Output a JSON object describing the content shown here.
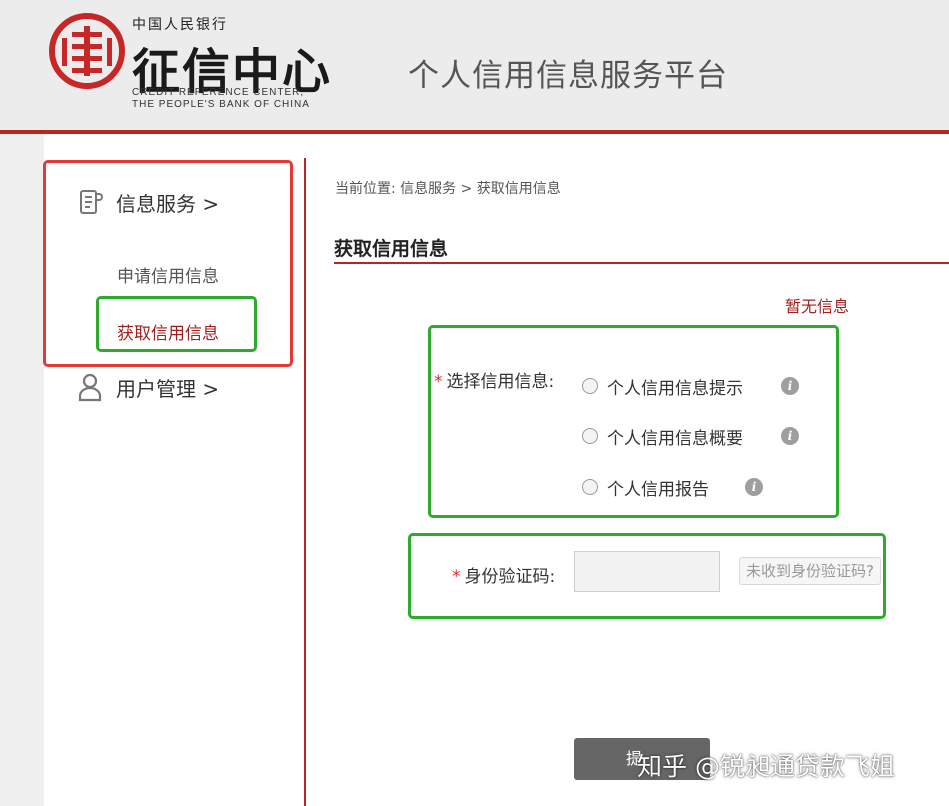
{
  "header": {
    "logo_top": "中国人民银行",
    "logo_main": "征信中心",
    "logo_en_line1": "CREDIT REFERENCE CENTER,",
    "logo_en_line2": "THE PEOPLE'S BANK OF CHINA",
    "platform_title": "个人信用信息服务平台"
  },
  "sidebar": {
    "groups": [
      {
        "label": "信息服务 >",
        "icon": "document-icon"
      },
      {
        "label": "用户管理 >",
        "icon": "user-icon"
      }
    ],
    "sub_items": [
      {
        "label": "申请信用信息",
        "active": false
      },
      {
        "label": "获取信用信息",
        "active": true
      }
    ]
  },
  "breadcrumb": "当前位置: 信息服务 > 获取信用信息",
  "page_title": "获取信用信息",
  "status_text": "暂无信息",
  "form": {
    "required_mark": "*",
    "select_label": "选择信用信息:",
    "options": [
      {
        "label": "个人信用信息提示",
        "selected": false
      },
      {
        "label": "个人信用信息概要",
        "selected": false
      },
      {
        "label": "个人信用报告",
        "selected": false
      }
    ],
    "info_glyph": "i",
    "code_label": "身份验证码:",
    "code_value": "",
    "code_link": "未收到身份验证码?",
    "submit_label": "提"
  },
  "watermark": "知乎 @锐昶通贷款飞姐",
  "colors": {
    "brand_red": "#b8261f",
    "active_text": "#a31f1f",
    "annotation_red": "#e53935",
    "annotation_green": "#2eaa2e"
  }
}
